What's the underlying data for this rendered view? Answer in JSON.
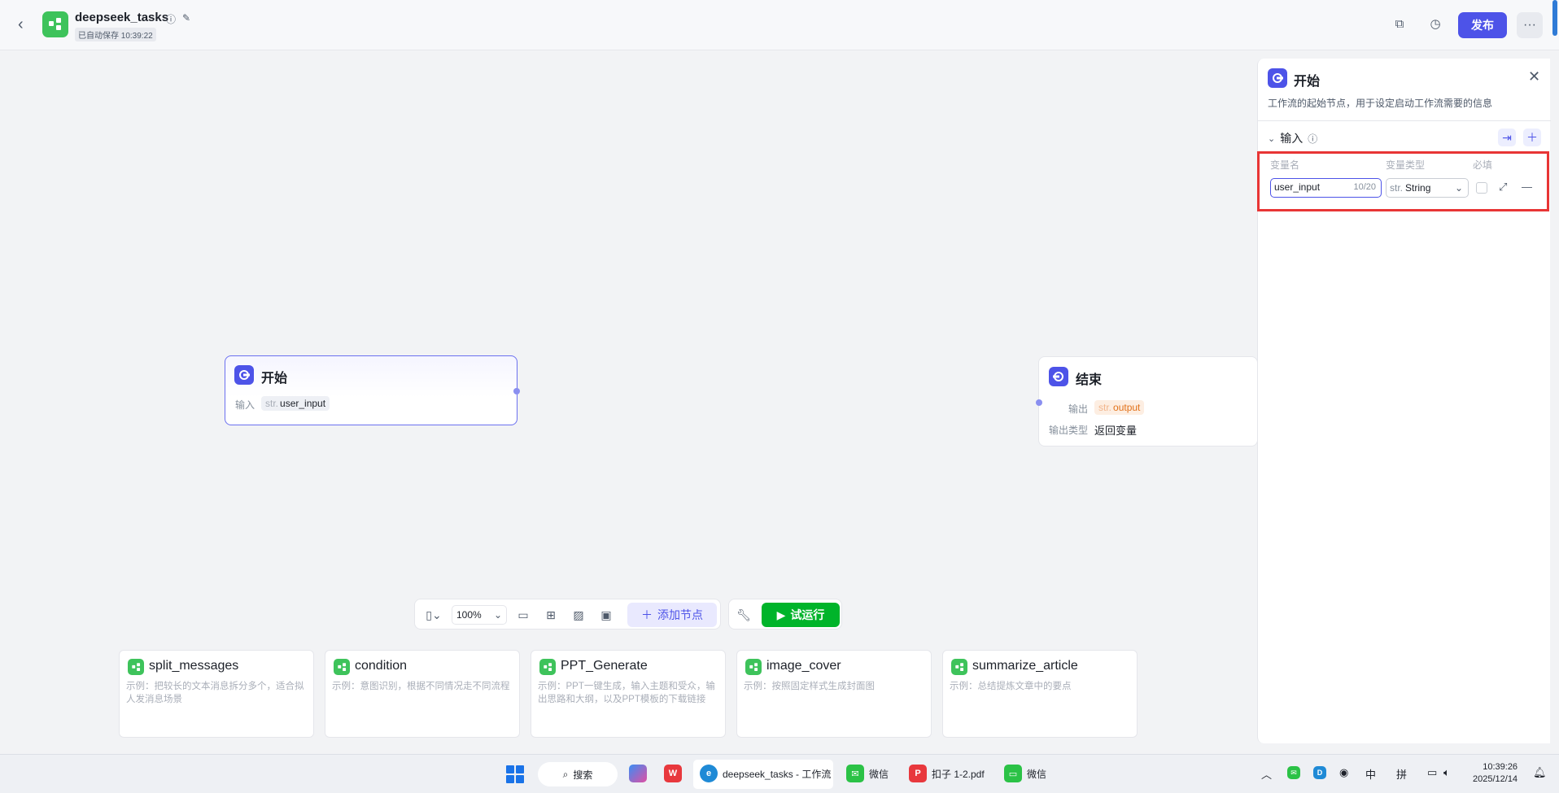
{
  "header": {
    "app_title": "deepseek_tasks",
    "autosave": "已自动保存 10:39:22",
    "publish_label": "发布",
    "more_label": "···"
  },
  "start_node": {
    "title": "开始",
    "input_label": "输入",
    "input_type": "str.",
    "input_var": "user_input"
  },
  "end_node": {
    "title": "结束",
    "output_label": "输出",
    "output_type": "str.",
    "output_var": "output",
    "output_type_label": "输出类型",
    "output_type_value": "返回变量"
  },
  "toolbar": {
    "zoom": "100%",
    "add_node_label": "添加节点",
    "run_label": "试运行"
  },
  "templates": [
    {
      "title": "split_messages",
      "desc": "示例：把较长的文本消息拆分多个，适合拟人发消息场景"
    },
    {
      "title": "condition",
      "desc": "示例：意图识别，根据不同情况走不同流程"
    },
    {
      "title": "PPT_Generate",
      "desc": "示例：PPT一键生成，输入主题和受众，输出思路和大纲，以及PPT模板的下载链接"
    },
    {
      "title": "image_cover",
      "desc": "示例：按照固定样式生成封面图"
    },
    {
      "title": "summarize_article",
      "desc": "示例：总结提炼文章中的要点"
    }
  ],
  "panel": {
    "title": "开始",
    "description": "工作流的起始节点，用于设定启动工作流需要的信息",
    "section_label": "输入",
    "col_name": "变量名",
    "col_type": "变量类型",
    "col_required": "必填",
    "var_name_value": "user_input",
    "var_name_count": "10/20",
    "var_type_prefix": "str.",
    "var_type_value": "String"
  },
  "taskbar": {
    "search_label": "搜索",
    "browser_tab": "deepseek_tasks - 工作流",
    "wechat1": "微信",
    "pdf_label": "扣子 1-2.pdf",
    "wechat2": "微信",
    "ime1": "中",
    "ime2": "拼",
    "time": "10:39:26",
    "date": "2025/12/14"
  },
  "colors": {
    "accent": "#4d53e8",
    "run_green": "#00b42a",
    "logo_green": "#3ec35b",
    "highlight_red": "#e83535"
  }
}
